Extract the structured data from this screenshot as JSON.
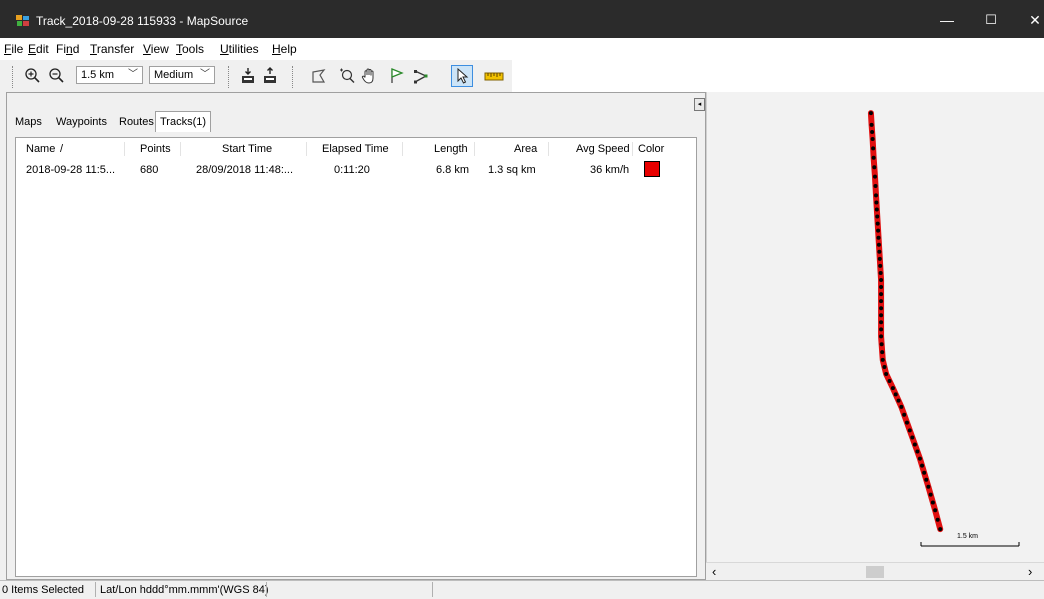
{
  "window": {
    "title": "Track_2018-09-28 115933 - MapSource",
    "controls": {
      "minimize": "—",
      "maximize": "☐",
      "close": "✕"
    }
  },
  "menu": {
    "items": [
      {
        "pre": "",
        "u": "F",
        "post": "ile"
      },
      {
        "pre": "",
        "u": "E",
        "post": "dit"
      },
      {
        "pre": "Fi",
        "u": "n",
        "post": "d"
      },
      {
        "pre": "",
        "u": "T",
        "post": "ransfer"
      },
      {
        "pre": "",
        "u": "V",
        "post": "iew"
      },
      {
        "pre": "",
        "u": "T",
        "post": "ools"
      },
      {
        "pre": "",
        "u": "U",
        "post": "tilities"
      },
      {
        "pre": "",
        "u": "H",
        "post": "elp"
      }
    ]
  },
  "toolbar": {
    "zoom_value": "1.5 km",
    "detail_value": "Medium",
    "icons": [
      "zoom-in-icon",
      "zoom-out-icon",
      "receive-from-device-icon",
      "send-to-device-icon",
      "map-select-icon",
      "zoom-tool-icon",
      "hand-pan-icon",
      "waypoint-flag-icon",
      "route-tool-icon",
      "select-pointer-icon",
      "distance-ruler-icon"
    ]
  },
  "tabs": [
    "Maps",
    "Waypoints",
    "Routes",
    "Tracks(1)"
  ],
  "tracks_table": {
    "columns": [
      "Name",
      "/",
      "Points",
      "Start Time",
      "Elapsed Time",
      "Length",
      "Area",
      "Avg Speed",
      "Color"
    ],
    "rows": [
      {
        "name": "2018-09-28 11:5...",
        "points": "680",
        "start_time": "28/09/2018 11:48:...",
        "elapsed": "0:11:20",
        "length": "6.8 km",
        "area": "1.3 sq km",
        "avg_speed": "36 km/h",
        "color": "#e80000"
      }
    ]
  },
  "map": {
    "scale_label": "1.5 km",
    "track_color": "#e01010",
    "point_color": "#000000",
    "track_points": [
      [
        0.485,
        0.045
      ],
      [
        0.487,
        0.07
      ],
      [
        0.49,
        0.1
      ],
      [
        0.493,
        0.14
      ],
      [
        0.497,
        0.18
      ],
      [
        0.5,
        0.22
      ],
      [
        0.505,
        0.28
      ],
      [
        0.51,
        0.34
      ],
      [
        0.515,
        0.4
      ],
      [
        0.515,
        0.46
      ],
      [
        0.515,
        0.52
      ],
      [
        0.52,
        0.57
      ],
      [
        0.53,
        0.6
      ],
      [
        0.55,
        0.63
      ],
      [
        0.575,
        0.67
      ],
      [
        0.6,
        0.72
      ],
      [
        0.63,
        0.78
      ],
      [
        0.655,
        0.84
      ],
      [
        0.675,
        0.89
      ],
      [
        0.69,
        0.93
      ]
    ]
  },
  "status": {
    "selected": "0 Items Selected",
    "coord_format": "Lat/Lon hddd°mm.mmm'(WGS 84)"
  },
  "scroll": {
    "left_arrow": "‹",
    "right_arrow": "›"
  },
  "collapse_glyph": "◂"
}
